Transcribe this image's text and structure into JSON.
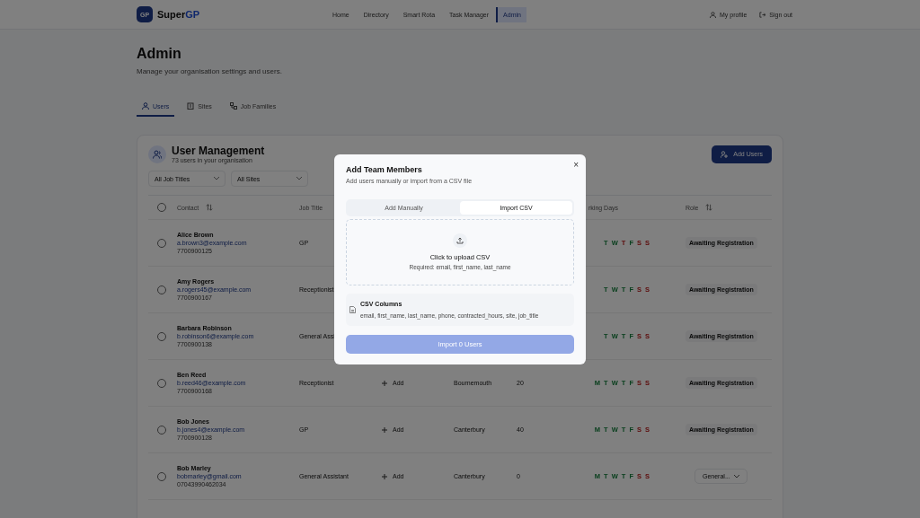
{
  "nav": {
    "logo_badge": "GP",
    "brand_start": "Super",
    "brand_end": "GP",
    "items": [
      {
        "label": "Home",
        "selected": false
      },
      {
        "label": "Directory",
        "selected": false
      },
      {
        "label": "Smart Rota",
        "selected": false
      },
      {
        "label": "Task Manager",
        "selected": false
      },
      {
        "label": "Admin",
        "selected": true
      }
    ],
    "profile": "My profile",
    "sign_out": "Sign out"
  },
  "page": {
    "title": "Admin",
    "subtitle": "Manage your organisation settings and users."
  },
  "tabs": [
    {
      "label": "Users",
      "kind": "users",
      "selected": true
    },
    {
      "label": "Sites",
      "kind": "sites",
      "selected": false
    },
    {
      "label": "Job Families",
      "kind": "families",
      "selected": false
    }
  ],
  "card": {
    "title": "User Management",
    "subtitle": "73 users in your organisation",
    "add_button": "Add Users",
    "filters": [
      "All Job Titles",
      "All Sites"
    ],
    "select_all_checked": false,
    "columns": {
      "contact": "Contact",
      "job_title": "Job Title",
      "working_days": "rking Days",
      "role": "Role"
    },
    "rows": [
      {
        "checked": false,
        "name": "Alice Brown",
        "email": "a.brown3@example.com",
        "phone": "7700900125",
        "job_title": "GP",
        "days": [
          {
            "d": "T",
            "on": true
          },
          {
            "d": "W",
            "on": true
          },
          {
            "d": "T",
            "on": false
          },
          {
            "d": "F",
            "on": true
          },
          {
            "d": "S",
            "on": false
          },
          {
            "d": "S",
            "on": false
          }
        ],
        "role": {
          "kind": "badge",
          "text": "Awaiting Registration"
        }
      },
      {
        "checked": false,
        "name": "Amy Rogers",
        "email": "a.rogers45@example.com",
        "phone": "7700900167",
        "job_title": "Receptionist",
        "days": [
          {
            "d": "T",
            "on": true
          },
          {
            "d": "W",
            "on": true
          },
          {
            "d": "T",
            "on": true
          },
          {
            "d": "F",
            "on": true
          },
          {
            "d": "S",
            "on": false
          },
          {
            "d": "S",
            "on": false
          }
        ],
        "role": {
          "kind": "badge",
          "text": "Awaiting Registration"
        }
      },
      {
        "checked": false,
        "name": "Barbara Robinson",
        "email": "b.robinson6@example.com",
        "phone": "7700900138",
        "job_title": "General Assi",
        "days": [
          {
            "d": "T",
            "on": true
          },
          {
            "d": "W",
            "on": true
          },
          {
            "d": "T",
            "on": true
          },
          {
            "d": "F",
            "on": true
          },
          {
            "d": "S",
            "on": false
          },
          {
            "d": "S",
            "on": false
          }
        ],
        "role": {
          "kind": "badge",
          "text": "Awaiting Registration"
        }
      },
      {
        "checked": false,
        "name": "Ben Reed",
        "email": "b.reed46@example.com",
        "phone": "7700900168",
        "job_title": "Receptionist",
        "add": "Add",
        "site": "Bournemouth",
        "hours": "20",
        "days": [
          {
            "d": "M",
            "on": true
          },
          {
            "d": "T",
            "on": true
          },
          {
            "d": "W",
            "on": true
          },
          {
            "d": "T",
            "on": true
          },
          {
            "d": "F",
            "on": true
          },
          {
            "d": "S",
            "on": false
          },
          {
            "d": "S",
            "on": false
          }
        ],
        "role": {
          "kind": "badge",
          "text": "Awaiting Registration"
        }
      },
      {
        "checked": false,
        "name": "Bob Jones",
        "email": "b.jones4@example.com",
        "phone": "7700900128",
        "job_title": "GP",
        "add": "Add",
        "site": "Canterbury",
        "hours": "40",
        "days": [
          {
            "d": "M",
            "on": true
          },
          {
            "d": "T",
            "on": true
          },
          {
            "d": "W",
            "on": true
          },
          {
            "d": "T",
            "on": true
          },
          {
            "d": "F",
            "on": true
          },
          {
            "d": "S",
            "on": false
          },
          {
            "d": "S",
            "on": false
          }
        ],
        "role": {
          "kind": "badge",
          "text": "Awaiting Registration"
        }
      },
      {
        "checked": false,
        "name": "Bob Marley",
        "email": "bobmarley@gmail.com",
        "phone": "07043990462034",
        "job_title": "General Assistant",
        "add": "Add",
        "site": "Canterbury",
        "hours": "0",
        "days": [
          {
            "d": "M",
            "on": true
          },
          {
            "d": "T",
            "on": true
          },
          {
            "d": "W",
            "on": true
          },
          {
            "d": "T",
            "on": true
          },
          {
            "d": "F",
            "on": true
          },
          {
            "d": "S",
            "on": false
          },
          {
            "d": "S",
            "on": false
          }
        ],
        "role": {
          "kind": "select",
          "text": "General..."
        }
      }
    ]
  },
  "modal": {
    "title": "Add Team Members",
    "subtitle": "Add users manually or import from a CSV file",
    "close": "×",
    "tabs": [
      {
        "label": "Add Manually",
        "selected": false
      },
      {
        "label": "Import CSV",
        "selected": true
      }
    ],
    "upload_title": "Click to upload CSV",
    "upload_hint": "Required: email, first_name, last_name",
    "columns_title": "CSV Columns",
    "columns_list": "email, first_name, last_name, phone, contracted_hours, site, job_title",
    "import_button": "Import 0 Users",
    "import_disabled": true
  }
}
